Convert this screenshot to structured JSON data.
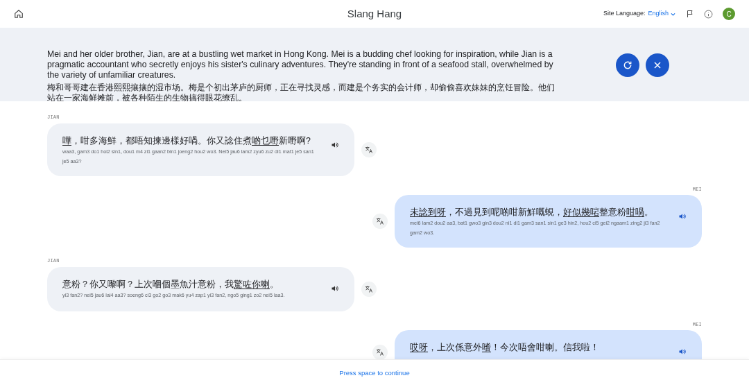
{
  "header": {
    "title": "Slang Hang",
    "site_language_label": "Site Language:",
    "site_language_value": "English",
    "avatar_letter": "C"
  },
  "scenario": {
    "english": "Mei and her older brother, Jian, are at a bustling wet market in Hong Kong. Mei is a budding chef looking for inspiration, while Jian is a pragmatic accountant who secretly enjoys his sister's culinary adventures. They're standing in front of a seafood stall, overwhelmed by the variety of unfamiliar creatures.",
    "chinese": "梅和哥哥建在香港熙熙攘攘的湿市场。梅是个初出茅庐的厨师，正在寻找灵感，而建是个务实的会计师，却偷偷喜欢妹妹的烹饪冒险。他们站在一家海鲜摊前，被各种陌生的生物搞得眼花缭乱。"
  },
  "messages": [
    {
      "speaker": "JIAN",
      "kind": "incoming",
      "segments": [
        {
          "text": "嘩",
          "underlined": true
        },
        {
          "text": "，咁多海鮮，都唔知揀邊樣好喎。你又諗住煮",
          "underlined": false
        },
        {
          "text": "啲乜嘢",
          "underlined": true
        },
        {
          "text": "新嘢啊?",
          "underlined": false
        }
      ],
      "romanization": "waa3, gam3 do1 hoi2 sin1, dou1 m4 zi1 gaan2 bin1 joeng2 hou2 wo3. Nei5 jau6 lam2 zyu6 zu2 di1 mat1 je5 san1 je5 aa3?"
    },
    {
      "speaker": "MEI",
      "kind": "outgoing",
      "segments": [
        {
          "text": "未諗到呀",
          "underlined": true
        },
        {
          "text": "，不過見到呢啲咁新鮮嘅蜆，",
          "underlined": false
        },
        {
          "text": "好似幾啱",
          "underlined": true
        },
        {
          "text": "整意粉",
          "underlined": false
        },
        {
          "text": "咁喎",
          "underlined": true
        },
        {
          "text": "。",
          "underlined": false
        }
      ],
      "romanization": "mei6 lam2 dou2 aa3, bat1 gwo3 gin3 dou2 ni1 di1 gam3 san1 sin1 ge3 hin2, hou2 ci5 gei2 ngaam1 zing2 ji3 fan2 gam2 wo3."
    },
    {
      "speaker": "JIAN",
      "kind": "incoming",
      "segments": [
        {
          "text": "意粉？你又嚟啊？上次嗰個墨魚汁意粉，我",
          "underlined": false
        },
        {
          "text": "驚咗你喇",
          "underlined": true
        },
        {
          "text": "。",
          "underlined": false
        }
      ],
      "romanization": "yi3 fan2? nei5 jau6 lai4 aa3? soeng6 ci3 go2 go3 mak6 yu4 zap1 yi3 fan2, ngo5 ging1 zo2 nei5 laa3."
    },
    {
      "speaker": "MEI",
      "kind": "outgoing",
      "segments": [
        {
          "text": "哎呀",
          "underlined": true
        },
        {
          "text": "，上次係意外",
          "underlined": false
        },
        {
          "text": "嗜",
          "underlined": true
        },
        {
          "text": "！今次唔會咁喇。信我啦！",
          "underlined": false
        }
      ]
    }
  ],
  "footer": {
    "hint": "Press space to continue"
  }
}
